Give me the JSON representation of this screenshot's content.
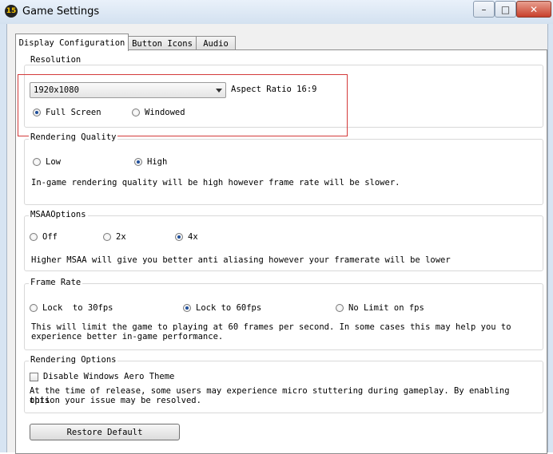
{
  "window": {
    "title": "Game Settings",
    "app_icon_text": "15",
    "minimize_icon": "minimize-icon",
    "maximize_icon": "maximize-icon",
    "close_icon": "close-icon"
  },
  "tabs": [
    {
      "label": "Display Configuration",
      "active": true
    },
    {
      "label": "Button Icons",
      "active": false
    },
    {
      "label": "Audio",
      "active": false
    }
  ],
  "resolution": {
    "label": "Resolution",
    "selected": "1920x1080",
    "aspect_ratio": "Aspect Ratio 16:9",
    "options": [
      {
        "label": "Full Screen",
        "checked": true
      },
      {
        "label": "Windowed",
        "checked": false
      }
    ]
  },
  "rendering_quality": {
    "label": "Rendering Quality",
    "options": [
      {
        "label": "Low",
        "checked": false
      },
      {
        "label": "High",
        "checked": true
      }
    ],
    "description": "In-game rendering quality will be high however frame rate will be slower."
  },
  "msaa": {
    "label": "MSAAOptions",
    "options": [
      {
        "label": "Off",
        "checked": false
      },
      {
        "label": "2x",
        "checked": false
      },
      {
        "label": "4x",
        "checked": true
      }
    ],
    "description": "Higher MSAA will give you better anti aliasing however your framerate will be lower"
  },
  "frame_rate": {
    "label": "Frame Rate",
    "options": [
      {
        "label": "Lock  to 30fps",
        "checked": false
      },
      {
        "label": "Lock to 60fps",
        "checked": true
      },
      {
        "label": "No Limit on fps",
        "checked": false
      }
    ],
    "description_line1": "This will limit the game to playing at 60 frames per second. In some cases this may help you to",
    "description_line2": "experience better in-game performance."
  },
  "rendering_options": {
    "label": "Rendering Options",
    "checkbox_label": "Disable Windows Aero Theme",
    "checked": false,
    "description_line1": "At the time of release, some users may experience micro stuttering during gameplay. By enabling this",
    "description_line2": "option your issue may be resolved."
  },
  "restore_default_label": "Restore Default",
  "colors": {
    "highlight_box": "#d33a3a",
    "radio_selected": "#1f4f9a",
    "close_button": "#c8402c"
  }
}
